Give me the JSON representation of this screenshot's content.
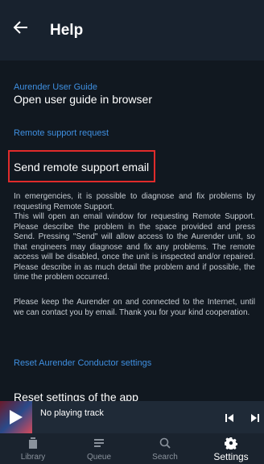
{
  "header": {
    "title": "Help"
  },
  "sections": {
    "guide_header": "Aurender User Guide",
    "guide_item": "Open user guide in browser",
    "remote_header": "Remote support request",
    "remote_item": "Send remote support email",
    "remote_desc_1": "In emergencies, it is possible to diagnose and fix problems by requesting Remote Support.",
    "remote_desc_2": "This will open an email window for requesting Remote Support. Please describe the problem in the space provided and press Send. Pressing \"Send\" will allow access to the Aurender unit, so that engineers may diagnose and fix any problems. The remote access will be disabled, once the unit is inspected and/or repaired. Please describe in as much detail the problem and if possible, the time the problem occurred.",
    "remote_desc_3": "Please keep the Aurender on and connected to the Internet, until we can contact you by email. Thank you for your kind cooperation.",
    "reset_header": "Reset Aurender Conductor settings",
    "reset_item": "Reset settings of the app"
  },
  "player": {
    "track": "No playing track"
  },
  "nav": {
    "tabs": [
      {
        "label": "Library",
        "icon": "library-icon"
      },
      {
        "label": "Queue",
        "icon": "queue-icon"
      },
      {
        "label": "Search",
        "icon": "search-icon"
      },
      {
        "label": "Settings",
        "icon": "gear-icon",
        "active": true
      }
    ]
  },
  "colors": {
    "accent": "#3f8fe0",
    "highlight": "#e02b2b",
    "appbar": "#18222e",
    "background": "#111820"
  }
}
